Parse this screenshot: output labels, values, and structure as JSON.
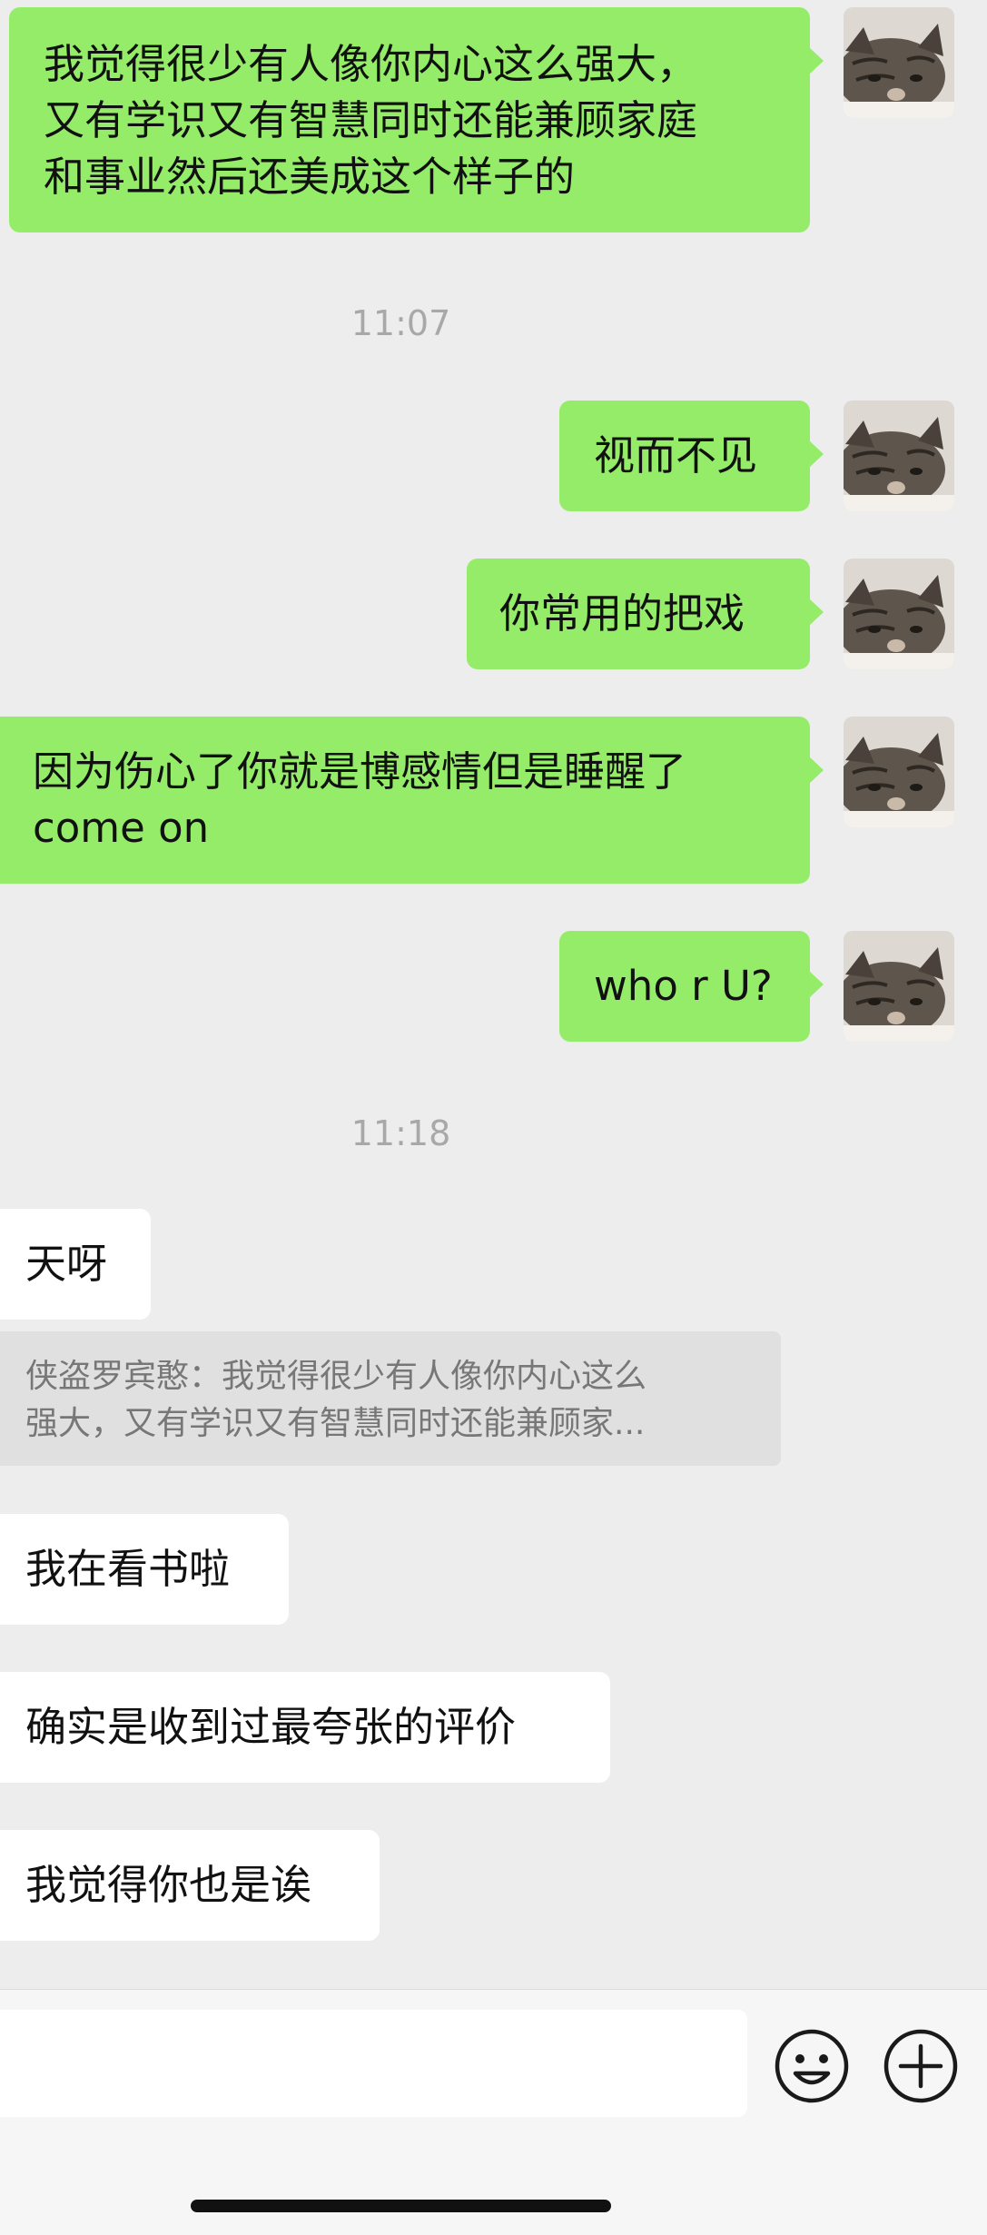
{
  "messages": {
    "m1": {
      "lines": [
        "我觉得很少有人像你内心这么强大，",
        "又有学识又有智慧同时还能兼顾家庭",
        "和事业然后还美成这个样子的"
      ]
    },
    "t1": "11:07",
    "m2": "视而不见",
    "m3": "你常用的把戏",
    "m4": {
      "lines": [
        "因为伤心了你就是博感情但是睡醒了",
        "come on"
      ]
    },
    "m5": "who r U?",
    "t2": "11:18",
    "r1": "天呀",
    "quote": {
      "lines": [
        "侠盗罗宾憨：我觉得很少有人像你内心这么",
        "强大，又有学识又有智慧同时还能兼顾家..."
      ]
    },
    "r2": "我在看书啦",
    "r3": "确实是收到过最夸张的评价",
    "r4": "我觉得你也是诶"
  },
  "input_bar": {
    "text_value": "",
    "icons": [
      "emoji-icon",
      "plus-icon"
    ]
  },
  "colors": {
    "outgoing_bubble": "#95ec69",
    "incoming_bubble": "#ffffff",
    "background": "#ededed",
    "timestamp": "#a8a8a8"
  }
}
